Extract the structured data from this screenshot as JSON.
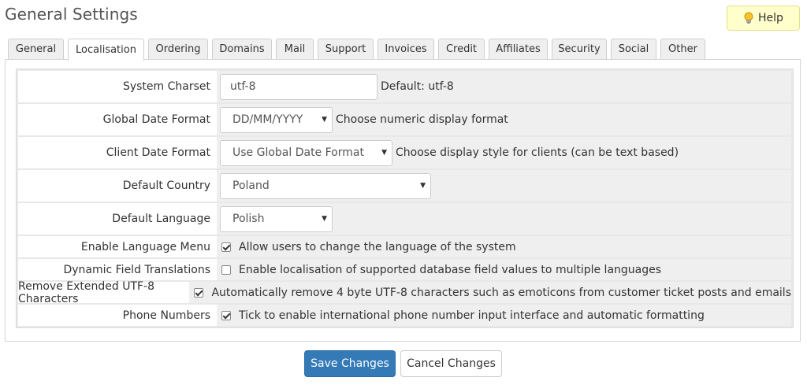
{
  "page": {
    "title": "General Settings"
  },
  "help": {
    "label": "Help",
    "icon": "lightbulb-icon"
  },
  "tabs": [
    {
      "label": "General",
      "active": false
    },
    {
      "label": "Localisation",
      "active": true
    },
    {
      "label": "Ordering",
      "active": false
    },
    {
      "label": "Domains",
      "active": false
    },
    {
      "label": "Mail",
      "active": false
    },
    {
      "label": "Support",
      "active": false
    },
    {
      "label": "Invoices",
      "active": false
    },
    {
      "label": "Credit",
      "active": false
    },
    {
      "label": "Affiliates",
      "active": false
    },
    {
      "label": "Security",
      "active": false
    },
    {
      "label": "Social",
      "active": false
    },
    {
      "label": "Other",
      "active": false
    }
  ],
  "settings": {
    "charset": {
      "label": "System Charset",
      "value": "utf-8",
      "hint": "Default: utf-8"
    },
    "global_date": {
      "label": "Global Date Format",
      "value": "DD/MM/YYYY",
      "hint": "Choose numeric display format"
    },
    "client_date": {
      "label": "Client Date Format",
      "value": "Use Global Date Format",
      "hint": "Choose display style for clients (can be text based)"
    },
    "country": {
      "label": "Default Country",
      "value": "Poland"
    },
    "language": {
      "label": "Default Language",
      "value": "Polish"
    },
    "language_menu": {
      "label": "Enable Language Menu",
      "checked": true,
      "text": "Allow users to change the language of the system"
    },
    "field_translations": {
      "label": "Dynamic Field Translations",
      "checked": false,
      "text": "Enable localisation of supported database field values to multiple languages"
    },
    "remove_utf8": {
      "label": "Remove Extended UTF-8 Characters",
      "checked": true,
      "text": "Automatically remove 4 byte UTF-8 characters such as emoticons from customer ticket posts and emails"
    },
    "phone_numbers": {
      "label": "Phone Numbers",
      "checked": true,
      "text": "Tick to enable international phone number input interface and automatic formatting"
    }
  },
  "actions": {
    "save": "Save Changes",
    "cancel": "Cancel Changes"
  },
  "colors": {
    "primary": "#337ab7",
    "help_bg": "#ffffcc",
    "highlight": "#d9222a"
  }
}
